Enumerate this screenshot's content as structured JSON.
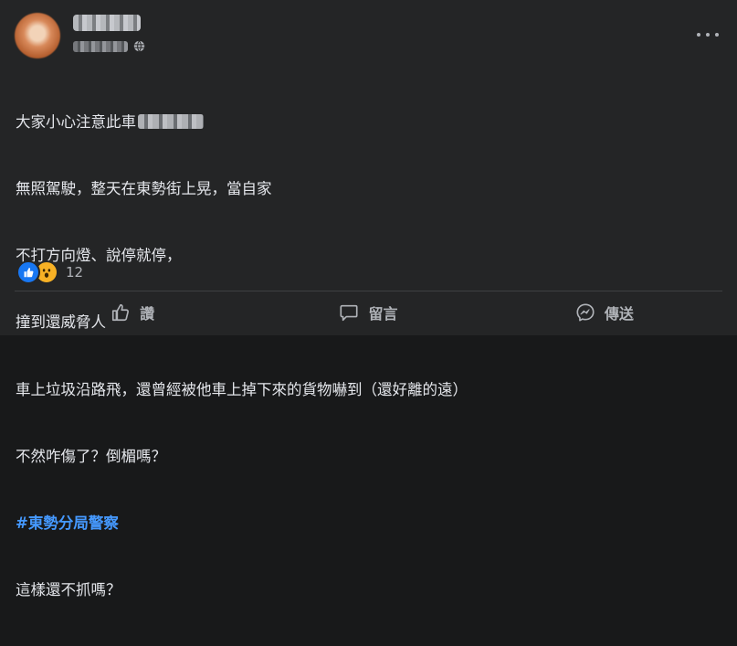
{
  "post": {
    "lines": [
      "大家小心注意此車",
      "無照駕駛，整天在東勢街上晃，當自家",
      "不打方向燈、說停就停，",
      "撞到還威脅人",
      "車上垃圾沿路飛，還曾經被他車上掉下來的貨物嚇到（還好離的遠）",
      "不然咋傷了？倒楣嗎？",
      "#東勢分局警察",
      "這樣還不抓嗎？"
    ]
  },
  "reactions": {
    "count": "12",
    "types": [
      "like",
      "wow"
    ]
  },
  "actions": {
    "like_label": "讚",
    "comment_label": "留言",
    "share_label": "傳送"
  },
  "icons": {
    "audience": "globe-icon",
    "menu": "more-icon",
    "like": "thumbs-up-icon",
    "comment": "comment-bubble-icon",
    "share": "messenger-icon"
  },
  "colors": {
    "background": "#242526",
    "text": "#e4e6eb",
    "secondary": "#b0b3b8",
    "hashtag": "#4599ff",
    "like_blue": "#1877f2",
    "wow_yellow": "#f7b125"
  }
}
